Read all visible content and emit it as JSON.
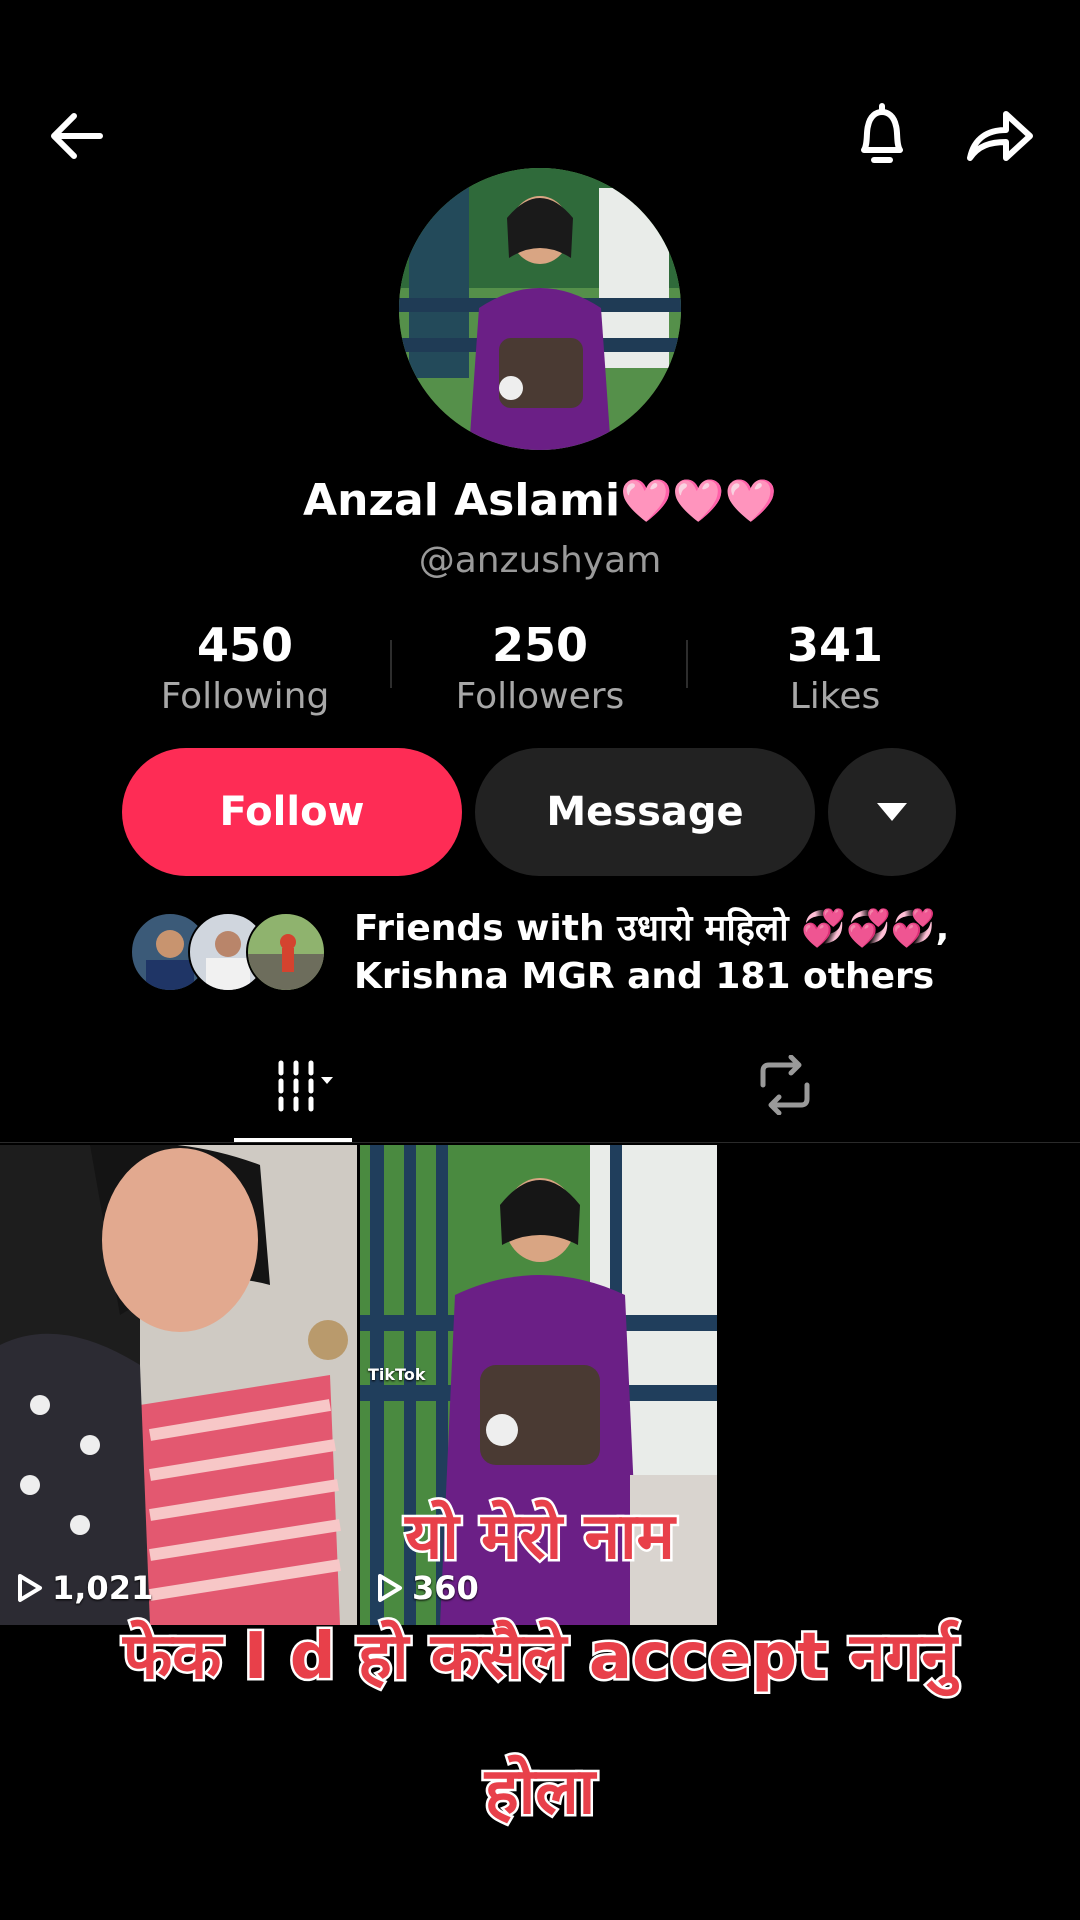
{
  "header": {
    "back_icon": "arrow-left-icon",
    "bell_icon": "bell-icon",
    "share_icon": "share-arrow-icon"
  },
  "profile": {
    "name": "Anzal Aslami",
    "name_emojis": "🩷🩷🩷",
    "handle": "@anzushyam"
  },
  "stats": [
    {
      "value": "450",
      "label": "Following"
    },
    {
      "value": "250",
      "label": "Followers"
    },
    {
      "value": "341",
      "label": "Likes"
    }
  ],
  "actions": {
    "follow_label": "Follow",
    "message_label": "Message",
    "more_icon": "caret-down-icon"
  },
  "friends": {
    "line1": "Friends with उधारो महिलो 💞💞💞,",
    "line2": "Krishna MGR and 181 others"
  },
  "tabs": {
    "videos_icon": "grid-icon",
    "reposts_icon": "repost-icon"
  },
  "videos": [
    {
      "views": "1,021"
    },
    {
      "views": "360",
      "watermark": "TikTok"
    }
  ],
  "overlay_text": {
    "line1": "यो मेरो नाम",
    "line2": "फेक I d हो कसैले accept नगर्नु",
    "line3": "होला"
  },
  "colors": {
    "accent": "#fe2c55",
    "overlay_red": "#e8404a"
  }
}
